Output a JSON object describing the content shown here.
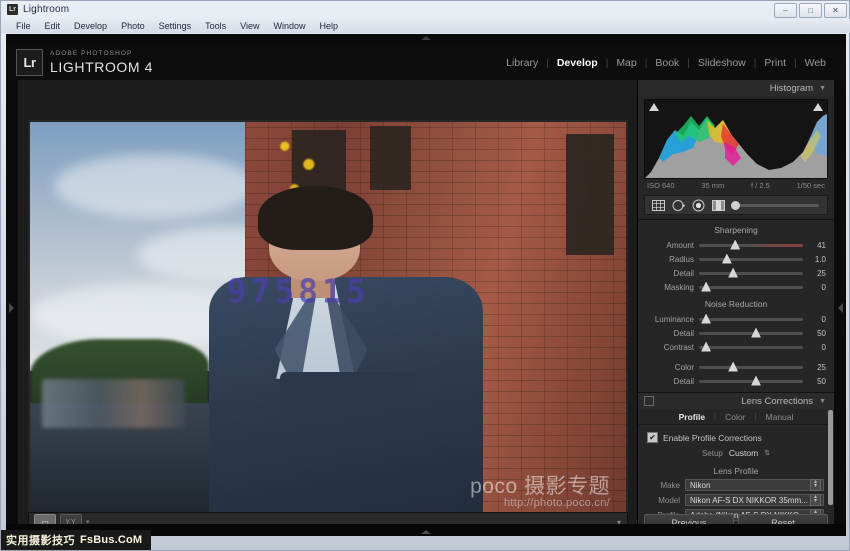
{
  "window": {
    "title": "Lightroom",
    "icon": "Lr",
    "minimize": "–",
    "maximize": "□",
    "close": "✕"
  },
  "menubar": {
    "items": [
      "File",
      "Edit",
      "Develop",
      "Photo",
      "Settings",
      "Tools",
      "View",
      "Window",
      "Help"
    ]
  },
  "branding": {
    "badge": "Lr",
    "sub": "ADOBE PHOTOSHOP",
    "main": "LIGHTROOM 4"
  },
  "modules": {
    "items": [
      "Library",
      "Develop",
      "Map",
      "Book",
      "Slideshow",
      "Print",
      "Web"
    ],
    "active": "Develop",
    "separator": "|"
  },
  "histogram": {
    "title": "Histogram",
    "chevron": "▼",
    "iso": "ISO 640",
    "focal": "35 mm",
    "aperture": "f / 2.5",
    "shutter": "1/50 sec"
  },
  "tools": {
    "crop": "crop-overlay-icon",
    "spot": "spot-removal-icon",
    "redeye": "red-eye-icon",
    "graduated": "graduated-filter-icon",
    "brush": "adjustment-brush-icon"
  },
  "sharpening": {
    "title": "Sharpening",
    "rows": [
      {
        "label": "Amount",
        "value": "41",
        "pos": 30,
        "tinted": true
      },
      {
        "label": "Radius",
        "value": "1.0",
        "pos": 22,
        "tinted": false
      },
      {
        "label": "Detail",
        "value": "25",
        "pos": 28,
        "tinted": false
      },
      {
        "label": "Masking",
        "value": "0",
        "pos": 2,
        "tinted": false
      }
    ]
  },
  "noise_reduction": {
    "title": "Noise Reduction",
    "rows": [
      {
        "label": "Luminance",
        "value": "0",
        "pos": 2,
        "tinted": false
      },
      {
        "label": "Detail",
        "value": "50",
        "pos": 50,
        "tinted": false
      },
      {
        "label": "Contrast",
        "value": "0",
        "pos": 2,
        "tinted": false
      },
      {
        "label": "Color",
        "value": "25",
        "pos": 28,
        "tinted": false
      },
      {
        "label": "Detail",
        "value": "50",
        "pos": 50,
        "tinted": false
      }
    ]
  },
  "lens_corrections": {
    "title": "Lens Corrections",
    "chevron": "▼",
    "tabs": [
      "Profile",
      "Color",
      "Manual"
    ],
    "active_tab": "Profile",
    "tab_separator": "|",
    "enable_label": "Enable Profile Corrections",
    "enable_checked": "✔",
    "setup_label": "Setup",
    "setup_value": "Custom",
    "setup_arrows": "⇅",
    "lens_profile_title": "Lens Profile",
    "fields": [
      {
        "label": "Make",
        "value": "Nikon"
      },
      {
        "label": "Model",
        "value": "Nikon AF-S DX NIKKOR 35mm..."
      },
      {
        "label": "Profile",
        "value": "Adobe (Nikon AF-S DX NIKKO..."
      }
    ]
  },
  "panel_buttons": {
    "previous": "Previous",
    "reset": "Reset"
  },
  "photo_toolbar": {
    "loupe": "loupe-view-icon",
    "compare": "YY",
    "caret": "▾",
    "right_caret": "▾"
  },
  "photo": {
    "watermark_digits": "975815",
    "watermark_brand": "poco 摄影专题",
    "watermark_url": "http://photo.poco.cn/"
  },
  "overlay_watermark": {
    "cn": "实用摄影技巧",
    "en": "FsBus.CoM"
  },
  "rails": {
    "left_arrow": "▶",
    "right_arrow": "◀",
    "top_arrow": "▲",
    "bottom_arrow": "▲"
  },
  "colors": {
    "panel_bg": "#262626",
    "app_bg": "#1e1e1e",
    "accent_text": "#ffffff",
    "watermark_digits": "#4a40aa"
  }
}
